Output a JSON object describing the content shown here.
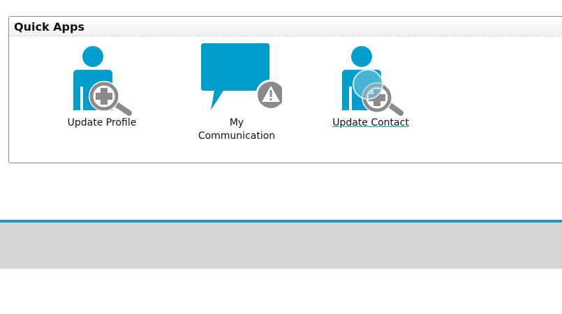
{
  "panel": {
    "title": "Quick Apps"
  },
  "apps": [
    {
      "label": "Update Profile",
      "icon": "user-zoom-plus-icon"
    },
    {
      "label_line1": "My",
      "label_line2": "Communication",
      "icon": "speech-bubble-warning-icon"
    },
    {
      "label": "Update Contact",
      "icon": "user-zoom-plus-icon",
      "hovered": true
    }
  ],
  "colors": {
    "accent": "#009fcb",
    "icon_gray": "#8a8a8a",
    "footer_strip": "#1a9bbd",
    "footer_bar": "#d5d5d5"
  }
}
